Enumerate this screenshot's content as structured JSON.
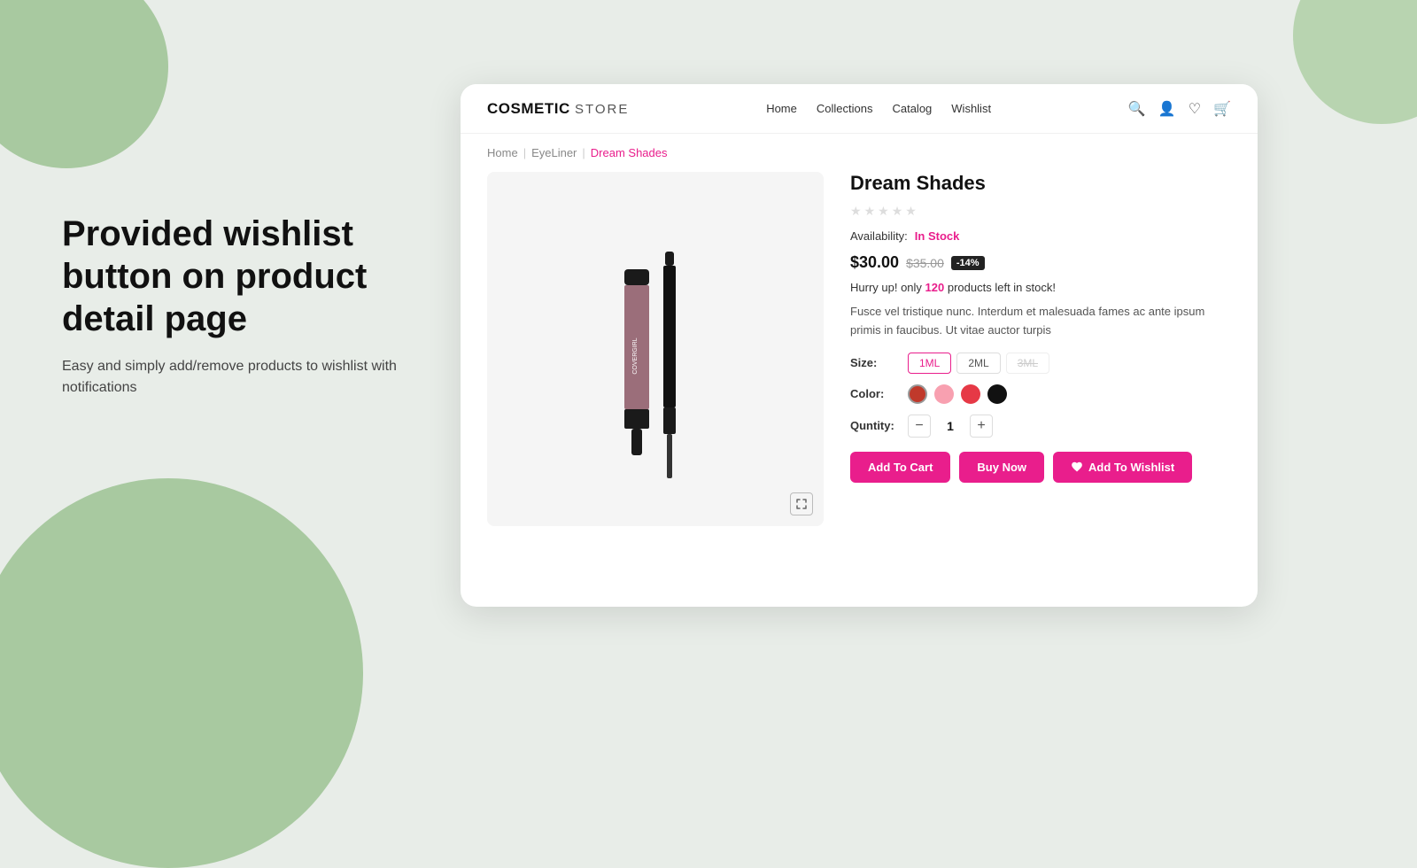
{
  "background": {
    "color": "#e8ede8"
  },
  "left_panel": {
    "heading": "Provided wishlist button on product detail page",
    "subtext": "Easy and simply add/remove products to wishlist with notifications"
  },
  "navbar": {
    "brand": "COSMETIC",
    "brand_suffix": "STORE",
    "links": [
      "Home",
      "Collections",
      "Catalog",
      "Wishlist"
    ],
    "icons": [
      "search",
      "user",
      "heart",
      "cart"
    ]
  },
  "breadcrumb": {
    "items": [
      "Home",
      "EyeLiner",
      "Dream Shades"
    ],
    "active": "Dream Shades"
  },
  "product": {
    "title": "Dream Shades",
    "stars": 5,
    "availability_label": "Availability:",
    "availability_value": "In Stock",
    "price_current": "$30.00",
    "price_original": "$35.00",
    "price_badge": "-14%",
    "hurry_text": "Hurry up! only ",
    "hurry_count": "120",
    "hurry_suffix": " products left in stock!",
    "description": "Fusce vel tristique nunc. Interdum et malesuada fames ac ante ipsum primis in faucibus. Ut vitae auctor turpis",
    "size_label": "Size:",
    "sizes": [
      {
        "label": "1ML",
        "state": "active"
      },
      {
        "label": "2ML",
        "state": "normal"
      },
      {
        "label": "3ML",
        "state": "disabled"
      }
    ],
    "color_label": "Color:",
    "colors": [
      {
        "hex": "#c0392b",
        "selected": true
      },
      {
        "hex": "#f8a0b0",
        "selected": false
      },
      {
        "hex": "#e63946",
        "selected": false
      },
      {
        "hex": "#111111",
        "selected": false
      }
    ],
    "quantity_label": "Quntity:",
    "quantity_value": "1",
    "btn_cart": "Add To Cart",
    "btn_buy": "Buy Now",
    "btn_wishlist": "Add To Wishlist"
  }
}
